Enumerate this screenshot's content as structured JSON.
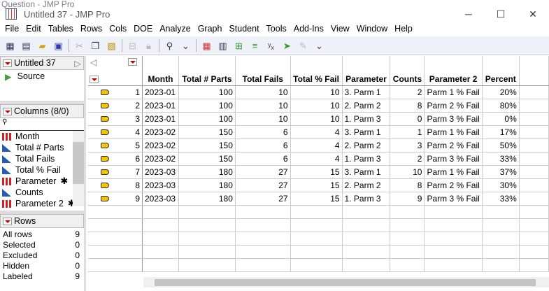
{
  "ghost_title": "Question - JMP Pro",
  "window": {
    "title": "Untitled 37 - JMP Pro",
    "minimize": "─",
    "maximize": "☐",
    "close": "✕"
  },
  "menu": [
    "File",
    "Edit",
    "Tables",
    "Rows",
    "Cols",
    "DOE",
    "Analyze",
    "Graph",
    "Student",
    "Tools",
    "Add-Ins",
    "View",
    "Window",
    "Help"
  ],
  "table_panel": {
    "title": "Untitled 37",
    "source": "Source"
  },
  "columns_panel": {
    "title": "Columns (8/0)",
    "items": [
      {
        "name": "Month",
        "type": "nominal",
        "star": ""
      },
      {
        "name": "Total # Parts",
        "type": "continuous",
        "star": ""
      },
      {
        "name": "Total Fails",
        "type": "continuous",
        "star": ""
      },
      {
        "name": "Total % Fail",
        "type": "continuous",
        "star": ""
      },
      {
        "name": "Parameter",
        "type": "nominal",
        "star": "✱"
      },
      {
        "name": "Counts",
        "type": "continuous",
        "star": ""
      },
      {
        "name": "Parameter 2",
        "type": "nominal",
        "star": "✱"
      }
    ]
  },
  "rows_panel": {
    "title": "Rows",
    "items": [
      {
        "label": "All rows",
        "value": "9"
      },
      {
        "label": "Selected",
        "value": "0"
      },
      {
        "label": "Excluded",
        "value": "0"
      },
      {
        "label": "Hidden",
        "value": "0"
      },
      {
        "label": "Labeled",
        "value": "9"
      }
    ]
  },
  "grid": {
    "headers": [
      "Month",
      "Total # Parts",
      "Total Fails",
      "Total % Fail",
      "Parameter",
      "Counts",
      "Parameter 2",
      "Percent"
    ],
    "rows": [
      [
        "1",
        "2023-01",
        "100",
        "10",
        "10",
        "3. Parm 1",
        "2",
        "Parm 1 % Fail",
        "20%"
      ],
      [
        "2",
        "2023-01",
        "100",
        "10",
        "10",
        "2. Parm 2",
        "8",
        "Parm 2 % Fail",
        "80%"
      ],
      [
        "3",
        "2023-01",
        "100",
        "10",
        "10",
        "1. Parm 3",
        "0",
        "Parm 3 % Fail",
        "0%"
      ],
      [
        "4",
        "2023-02",
        "150",
        "6",
        "4",
        "3. Parm 1",
        "1",
        "Parm 1 % Fail",
        "17%"
      ],
      [
        "5",
        "2023-02",
        "150",
        "6",
        "4",
        "2. Parm 2",
        "3",
        "Parm 2 % Fail",
        "50%"
      ],
      [
        "6",
        "2023-02",
        "150",
        "6",
        "4",
        "1. Parm 3",
        "2",
        "Parm 3 % Fail",
        "33%"
      ],
      [
        "7",
        "2023-03",
        "180",
        "27",
        "15",
        "3. Parm 1",
        "10",
        "Parm 1 % Fail",
        "37%"
      ],
      [
        "8",
        "2023-03",
        "180",
        "27",
        "15",
        "2. Parm 2",
        "8",
        "Parm 2 % Fail",
        "30%"
      ],
      [
        "9",
        "2023-03",
        "180",
        "27",
        "15",
        "1. Parm 3",
        "9",
        "Parm 3 % Fail",
        "33%"
      ]
    ]
  }
}
